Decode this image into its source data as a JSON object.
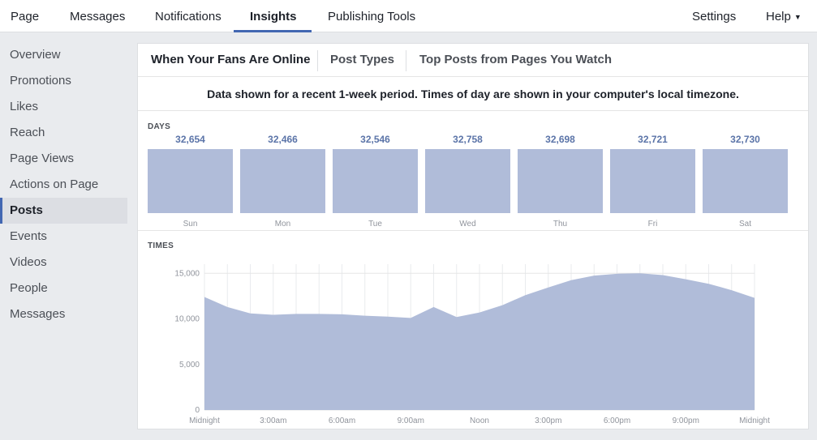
{
  "nav": {
    "items": [
      "Page",
      "Messages",
      "Notifications",
      "Insights",
      "Publishing Tools"
    ],
    "active": "Insights",
    "settings": "Settings",
    "help": "Help"
  },
  "sidebar": {
    "items": [
      "Overview",
      "Promotions",
      "Likes",
      "Reach",
      "Page Views",
      "Actions on Page",
      "Posts",
      "Events",
      "Videos",
      "People",
      "Messages"
    ],
    "active": "Posts"
  },
  "tabs": {
    "items": [
      "When Your Fans Are Online",
      "Post Types",
      "Top Posts from Pages You Watch"
    ],
    "active": "When Your Fans Are Online"
  },
  "notice": "Data shown for a recent 1-week period. Times of day are shown in your computer's local timezone.",
  "colors": {
    "accent": "#4267b2",
    "bar": "#b0bcd9",
    "value_label": "#5b74a8"
  },
  "chart_data": [
    {
      "type": "bar",
      "title": "DAYS",
      "categories": [
        "Sun",
        "Mon",
        "Tue",
        "Wed",
        "Thu",
        "Fri",
        "Sat"
      ],
      "values": [
        32654,
        32466,
        32546,
        32758,
        32698,
        32721,
        32730
      ],
      "value_labels": [
        "32,654",
        "32,466",
        "32,546",
        "32,758",
        "32,698",
        "32,721",
        "32,730"
      ]
    },
    {
      "type": "area",
      "title": "TIMES",
      "x_tick_labels": [
        "Midnight",
        "3:00am",
        "6:00am",
        "9:00am",
        "Noon",
        "3:00pm",
        "6:00pm",
        "9:00pm",
        "Midnight"
      ],
      "x_hours": [
        0,
        1,
        2,
        3,
        4,
        5,
        6,
        7,
        8,
        9,
        10,
        11,
        12,
        13,
        14,
        15,
        16,
        17,
        18,
        19,
        20,
        21,
        22,
        23,
        24
      ],
      "values": [
        12400,
        11300,
        10600,
        10450,
        10550,
        10550,
        10500,
        10350,
        10250,
        10100,
        11300,
        10200,
        10700,
        11500,
        12600,
        13450,
        14250,
        14750,
        14950,
        15000,
        14800,
        14350,
        13850,
        13150,
        12300
      ],
      "y_ticks": [
        0,
        5000,
        10000,
        15000
      ],
      "y_tick_labels": [
        "0",
        "5,000",
        "10,000",
        "15,000"
      ],
      "ylim": [
        0,
        16000
      ],
      "grid": true
    }
  ]
}
